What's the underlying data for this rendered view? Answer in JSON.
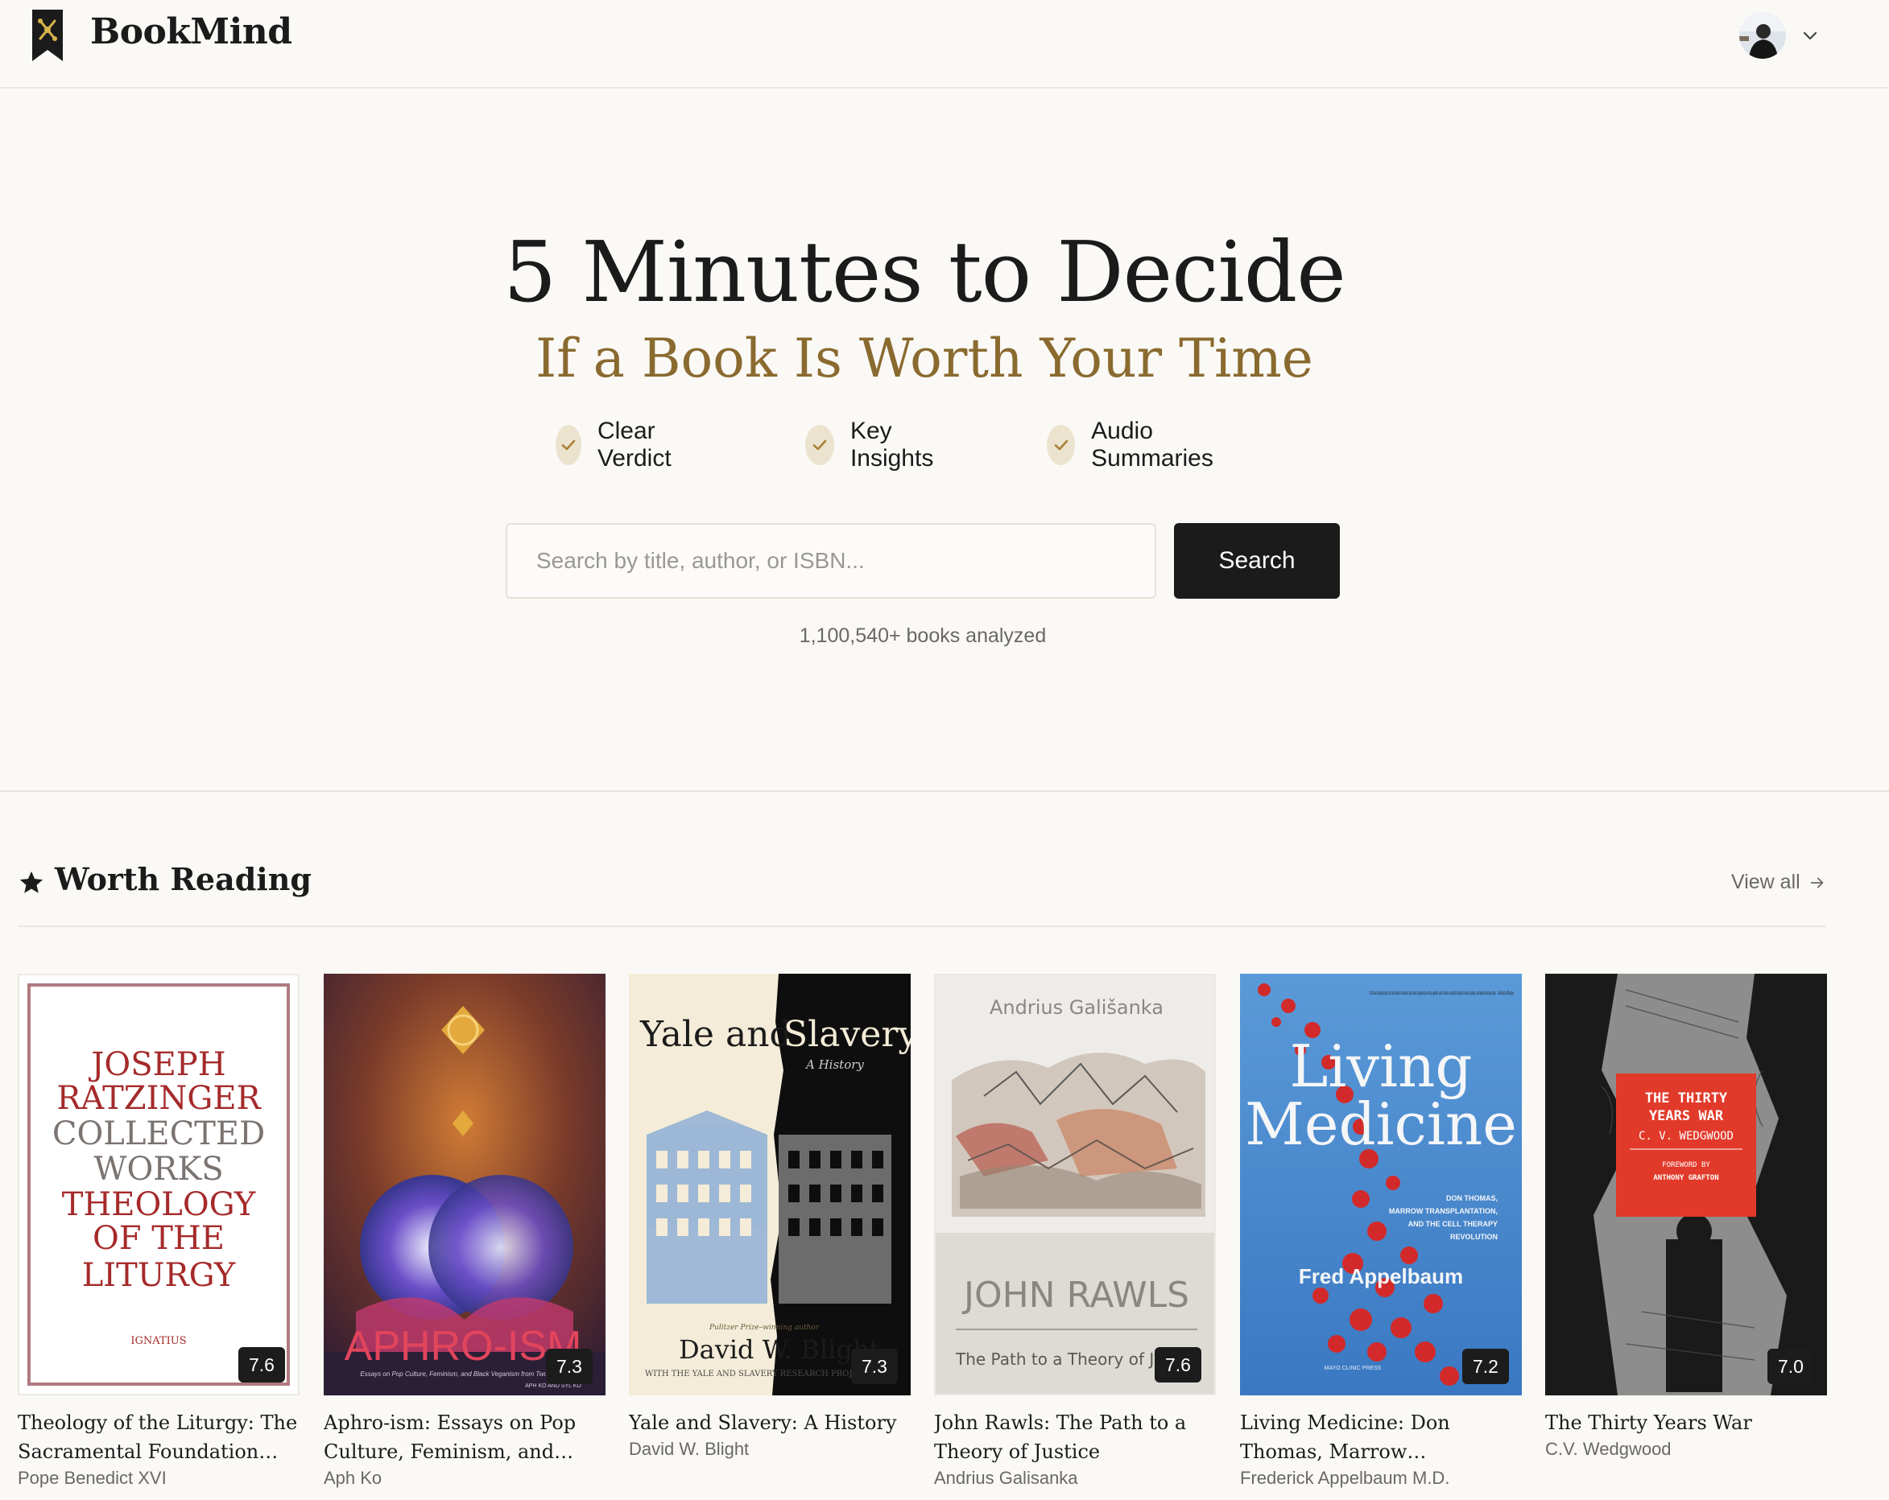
{
  "header": {
    "brand": "BookMind",
    "icons": {
      "logo": "bookmark-logo-icon",
      "avatar": "user-avatar",
      "menu": "chevron-down-icon"
    }
  },
  "hero": {
    "title": "5 Minutes to Decide",
    "subtitle": "If a Book Is Worth Your Time",
    "features": [
      "Clear Verdict",
      "Key Insights",
      "Audio Summaries"
    ],
    "search": {
      "placeholder": "Search by title, author, or ISBN...",
      "value": "",
      "button_label": "Search"
    },
    "books_count": "1,100,540+ books analyzed"
  },
  "section": {
    "title": "Worth Reading",
    "view_all": "View all",
    "icons": {
      "section": "star-icon",
      "view_all": "arrow-right-icon"
    }
  },
  "books": [
    {
      "title": "Theology of the Liturgy: The Sacramental Foundation of...",
      "author": "Pope Benedict XVI",
      "score": "7.6",
      "cover_text": [
        "JOSEPH",
        "RATZINGER",
        "COLLECTED",
        "WORKS",
        "THEOLOGY",
        "OF THE",
        "LITURGY",
        "IGNATIUS"
      ]
    },
    {
      "title": "Aphro-ism: Essays on Pop Culture, Feminism, and Black...",
      "author": "Aph Ko",
      "score": "7.3",
      "cover_text": [
        "APHRO-ISM",
        "Essays on Pop Culture, Feminism, and Black Veganism from Two Sisters",
        "APH KO AND SYL KO"
      ]
    },
    {
      "title": "Yale and Slavery: A History",
      "author": "David W. Blight",
      "score": "7.3",
      "cover_text": [
        "Yale and",
        "Slavery",
        "A History",
        "Pulitzer Prize–winning author",
        "David W. Blight",
        "WITH THE YALE AND SLAVERY RESEARCH PROJECT"
      ]
    },
    {
      "title": "John Rawls: The Path to a Theory of Justice",
      "author": "Andrius Galisanka",
      "score": "7.6",
      "cover_text": [
        "Andrius Gališanka",
        "JOHN RAWLS",
        "The Path to a Theory of Justice"
      ]
    },
    {
      "title": "Living Medicine: Don Thomas, Marrow Transplantation, and...",
      "author": "Frederick Appelbaum M.D.",
      "score": "7.2",
      "cover_text": [
        "“A vital and touching history, rich with details, excitement, and wonder. Appelbaum's writing sparkles, and the book is essential reading for doctors, patients, and medical historians alike.” —Siddhartha Mukherjee",
        "Living",
        "Medicine",
        "DON THOMAS,",
        "MARROW TRANSPLANTATION,",
        "AND THE CELL THERAPY",
        "REVOLUTION",
        "Fred Appelbaum",
        "MAYO CLINIC PRESS"
      ]
    },
    {
      "title": "The Thirty Years War",
      "author": "C.V. Wedgwood",
      "score": "7.0",
      "cover_text": [
        "THE THIRTY",
        "YEARS WAR",
        "C. V. WEDGWOOD",
        "FOREWORD BY",
        "ANTHONY GRAFTON"
      ]
    }
  ],
  "colors": {
    "background": "#faf9f6",
    "accent_gold": "#8a6a2f",
    "button_dark": "#1b1b1b",
    "check_bg": "#ece3cf"
  }
}
